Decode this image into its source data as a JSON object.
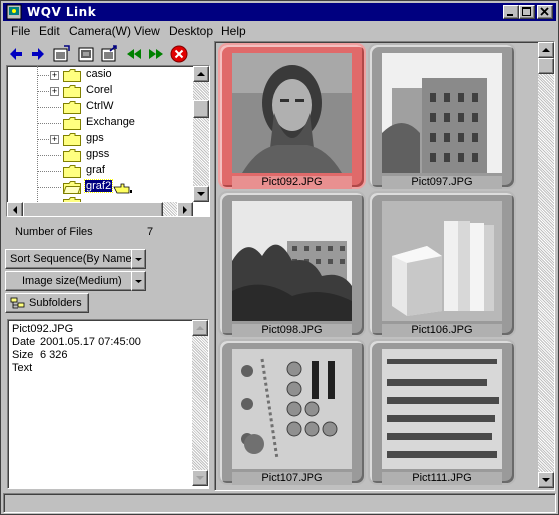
{
  "window": {
    "title": "WQV Link"
  },
  "menu": [
    "File",
    "Edit",
    "Camera(W)",
    "View",
    "Desktop",
    "Help"
  ],
  "toolbar": [
    "back-arrow-icon",
    "forward-arrow-icon",
    "import-image-icon",
    "camera-download-icon",
    "export-image-icon",
    "rewind-icon",
    "fast-forward-icon",
    "stop-icon"
  ],
  "tree": {
    "items": [
      {
        "label": "casio",
        "expandable": true,
        "selected": false
      },
      {
        "label": "Corel",
        "expandable": true,
        "selected": false
      },
      {
        "label": "CtrlW",
        "expandable": false,
        "selected": false
      },
      {
        "label": "Exchange",
        "expandable": false,
        "selected": false
      },
      {
        "label": "gps",
        "expandable": true,
        "selected": false
      },
      {
        "label": "gpss",
        "expandable": false,
        "selected": false
      },
      {
        "label": "graf",
        "expandable": false,
        "selected": false
      },
      {
        "label": "graf2",
        "expandable": false,
        "selected": true
      }
    ]
  },
  "files": {
    "label": "Number of Files",
    "count": "7"
  },
  "sort": {
    "value": "Sort Sequence(By Name)"
  },
  "imagesize": {
    "value": "Image size(Medium)"
  },
  "subfolders": {
    "label": "Subfolders"
  },
  "info": {
    "filename": "Pict092.JPG",
    "date_label": "Date",
    "date_value": "2001.05.17 07:45:00",
    "size_label": "Size",
    "size_value": "6 326",
    "text_label": "Text"
  },
  "thumbnails": [
    {
      "label": "Pict092.JPG",
      "selected": true
    },
    {
      "label": "Pict097.JPG",
      "selected": false
    },
    {
      "label": "Pict098.JPG",
      "selected": false
    },
    {
      "label": "Pict106.JPG",
      "selected": false
    },
    {
      "label": "Pict107.JPG",
      "selected": false
    },
    {
      "label": "Pict111.JPG",
      "selected": false
    }
  ],
  "colors": {
    "titlebar": "#000080",
    "selection": "#000080",
    "selected_tile": "#e06a6a"
  }
}
